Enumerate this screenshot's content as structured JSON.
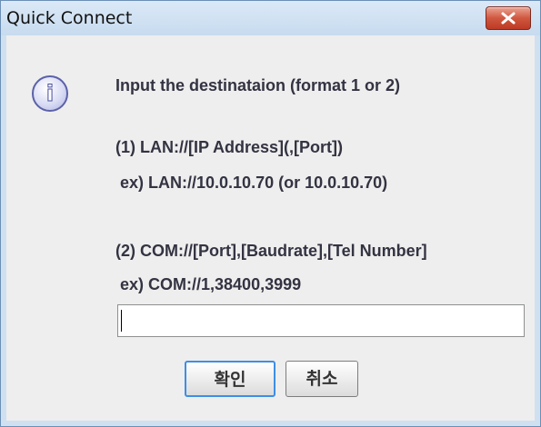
{
  "window": {
    "title": "Quick Connect",
    "close_icon": "close-icon"
  },
  "dialog": {
    "icon": "info-icon",
    "icon_glyph": "i",
    "lines": [
      "Input the destinataion (format 1 or 2)",
      "(1) LAN://[IP Address](,[Port])",
      " ex) LAN://10.0.10.70 (or 10.0.10.70)",
      "(2) COM://[Port],[Baudrate],[Tel Number]",
      " ex) COM://1,38400,3999"
    ],
    "input_value": ""
  },
  "buttons": {
    "ok_label": "확인",
    "cancel_label": "취소"
  }
}
